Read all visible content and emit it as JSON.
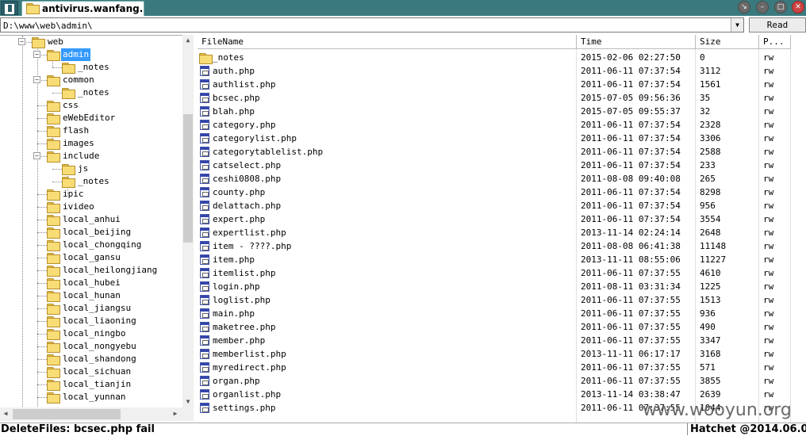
{
  "window": {
    "tab_title": "antivirus.wanfang..."
  },
  "address": {
    "path": "D:\\www\\web\\admin\\"
  },
  "toolbar": {
    "read_label": "Read"
  },
  "tree": [
    {
      "label": "web",
      "depth": 0,
      "expanded": true
    },
    {
      "label": "admin",
      "depth": 1,
      "expanded": true,
      "selected": true
    },
    {
      "label": "_notes",
      "depth": 2
    },
    {
      "label": "common",
      "depth": 1,
      "expanded": true
    },
    {
      "label": "_notes",
      "depth": 2
    },
    {
      "label": "css",
      "depth": 1
    },
    {
      "label": "eWebEditor",
      "depth": 1
    },
    {
      "label": "flash",
      "depth": 1
    },
    {
      "label": "images",
      "depth": 1
    },
    {
      "label": "include",
      "depth": 1,
      "expanded": true
    },
    {
      "label": "js",
      "depth": 2
    },
    {
      "label": "_notes",
      "depth": 2
    },
    {
      "label": "ipic",
      "depth": 1
    },
    {
      "label": "ivideo",
      "depth": 1
    },
    {
      "label": "local_anhui",
      "depth": 1
    },
    {
      "label": "local_beijing",
      "depth": 1
    },
    {
      "label": "local_chongqing",
      "depth": 1
    },
    {
      "label": "local_gansu",
      "depth": 1
    },
    {
      "label": "local_heilongjiang",
      "depth": 1
    },
    {
      "label": "local_hubei",
      "depth": 1
    },
    {
      "label": "local_hunan",
      "depth": 1
    },
    {
      "label": "local_jiangsu",
      "depth": 1
    },
    {
      "label": "local_liaoning",
      "depth": 1
    },
    {
      "label": "local_ningbo",
      "depth": 1
    },
    {
      "label": "local_nongyebu",
      "depth": 1
    },
    {
      "label": "local_shandong",
      "depth": 1
    },
    {
      "label": "local_sichuan",
      "depth": 1
    },
    {
      "label": "local_tianjin",
      "depth": 1
    },
    {
      "label": "local_yunnan",
      "depth": 1
    }
  ],
  "columns": {
    "name": "FileName",
    "time": "Time",
    "size": "Size",
    "perm": "P..."
  },
  "files": [
    {
      "name": "_notes",
      "time": "2015-02-06 02:27:50",
      "size": "0",
      "perm": "rw",
      "icon": "folder"
    },
    {
      "name": "auth.php",
      "time": "2011-06-11 07:37:54",
      "size": "3112",
      "perm": "rw",
      "icon": "php"
    },
    {
      "name": "authlist.php",
      "time": "2011-06-11 07:37:54",
      "size": "1561",
      "perm": "rw",
      "icon": "php"
    },
    {
      "name": "bcsec.php",
      "time": "2015-07-05 09:56:36",
      "size": "35",
      "perm": "rw",
      "icon": "php"
    },
    {
      "name": "blah.php",
      "time": "2015-07-05 09:55:37",
      "size": "32",
      "perm": "rw",
      "icon": "php"
    },
    {
      "name": "category.php",
      "time": "2011-06-11 07:37:54",
      "size": "2328",
      "perm": "rw",
      "icon": "php"
    },
    {
      "name": "categorylist.php",
      "time": "2011-06-11 07:37:54",
      "size": "3306",
      "perm": "rw",
      "icon": "php"
    },
    {
      "name": "categorytablelist.php",
      "time": "2011-06-11 07:37:54",
      "size": "2588",
      "perm": "rw",
      "icon": "php"
    },
    {
      "name": "catselect.php",
      "time": "2011-06-11 07:37:54",
      "size": "233",
      "perm": "rw",
      "icon": "php"
    },
    {
      "name": "ceshi0808.php",
      "time": "2011-08-08 09:40:08",
      "size": "265",
      "perm": "rw",
      "icon": "php"
    },
    {
      "name": "county.php",
      "time": "2011-06-11 07:37:54",
      "size": "8298",
      "perm": "rw",
      "icon": "php"
    },
    {
      "name": "delattach.php",
      "time": "2011-06-11 07:37:54",
      "size": "956",
      "perm": "rw",
      "icon": "php"
    },
    {
      "name": "expert.php",
      "time": "2011-06-11 07:37:54",
      "size": "3554",
      "perm": "rw",
      "icon": "php"
    },
    {
      "name": "expertlist.php",
      "time": "2013-11-14 02:24:14",
      "size": "2648",
      "perm": "rw",
      "icon": "php"
    },
    {
      "name": "item - ????.php",
      "time": "2011-08-08 06:41:38",
      "size": "11148",
      "perm": "rw",
      "icon": "php"
    },
    {
      "name": "item.php",
      "time": "2013-11-11 08:55:06",
      "size": "11227",
      "perm": "rw",
      "icon": "php"
    },
    {
      "name": "itemlist.php",
      "time": "2011-06-11 07:37:55",
      "size": "4610",
      "perm": "rw",
      "icon": "php"
    },
    {
      "name": "login.php",
      "time": "2011-08-11 03:31:34",
      "size": "1225",
      "perm": "rw",
      "icon": "php"
    },
    {
      "name": "loglist.php",
      "time": "2011-06-11 07:37:55",
      "size": "1513",
      "perm": "rw",
      "icon": "php"
    },
    {
      "name": "main.php",
      "time": "2011-06-11 07:37:55",
      "size": "936",
      "perm": "rw",
      "icon": "php"
    },
    {
      "name": "maketree.php",
      "time": "2011-06-11 07:37:55",
      "size": "490",
      "perm": "rw",
      "icon": "php"
    },
    {
      "name": "member.php",
      "time": "2011-06-11 07:37:55",
      "size": "3347",
      "perm": "rw",
      "icon": "php"
    },
    {
      "name": "memberlist.php",
      "time": "2013-11-11 06:17:17",
      "size": "3168",
      "perm": "rw",
      "icon": "php"
    },
    {
      "name": "myredirect.php",
      "time": "2011-06-11 07:37:55",
      "size": "571",
      "perm": "rw",
      "icon": "php"
    },
    {
      "name": "organ.php",
      "time": "2011-06-11 07:37:55",
      "size": "3855",
      "perm": "rw",
      "icon": "php"
    },
    {
      "name": "organlist.php",
      "time": "2013-11-14 03:38:47",
      "size": "2639",
      "perm": "rw",
      "icon": "php"
    },
    {
      "name": "settings.php",
      "time": "2011-06-11 07:37:55",
      "size": "1044",
      "perm": "rw",
      "icon": "php"
    }
  ],
  "status": {
    "message": "DeleteFiles: bcsec.php fail",
    "credit": "Hatchet @2014.06.06"
  },
  "watermark": "www.wooyun.org",
  "colors": {
    "titlebar": "#3a7a7e",
    "selection": "#3399ff",
    "folder": "#f8dc75"
  }
}
